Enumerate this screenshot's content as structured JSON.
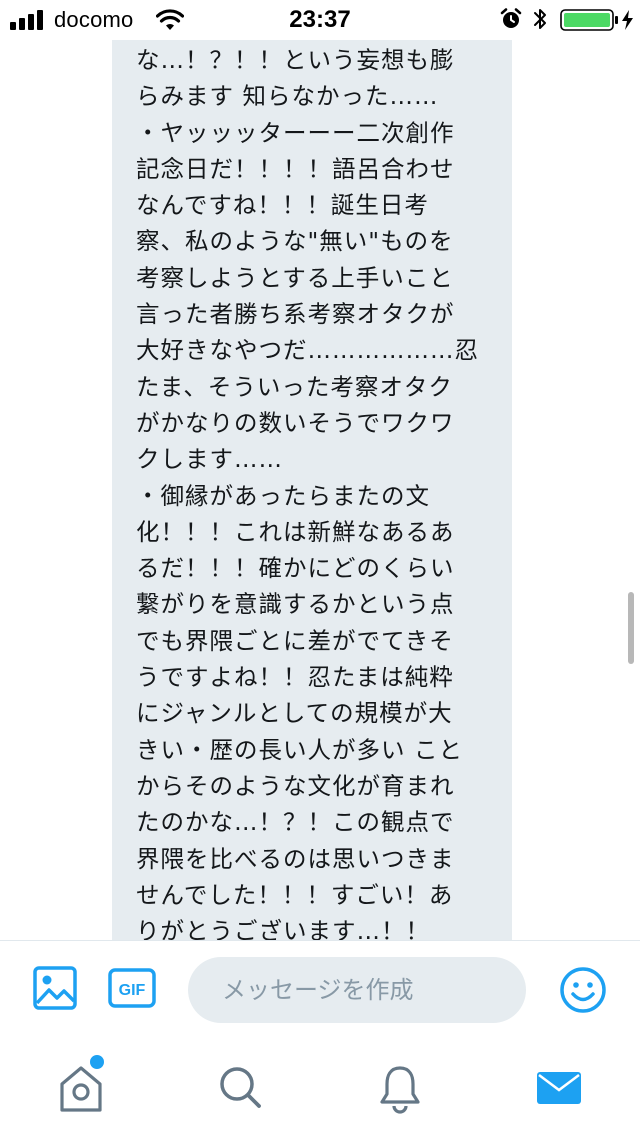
{
  "status_bar": {
    "carrier": "docomo",
    "time": "23:37"
  },
  "message": {
    "lines": [
      "な…！？！！という妄想も膨",
      "らみます 知らなかった……",
      "・ヤッッッターーー二次創作",
      "記念日だ！！！！語呂合わせ",
      "なんですね！！！誕生日考",
      "察、私のような\"無い\"ものを",
      "考察しようとする上手いこと",
      "言った者勝ち系考察オタクが",
      "大好きなやつだ………………忍",
      "たま、そういった考察オタク",
      "がかなりの数いそうでワクワ",
      "クします……",
      "・御縁があったらまたの文",
      "化！！！これは新鮮なあるあ",
      "るだ！！！確かにどのくらい",
      "繋がりを意識するかという点",
      "でも界隈ごとに差がでてきそ",
      "うですよね！！忍たまは純粋",
      "にジャンルとしての規模が大",
      "きい・歴の長い人が多い こと",
      "からそのような文化が育まれ",
      "たのかな…！？！この観点で",
      "界隈を比べるのは思いつきま",
      "せんでした！！！すごい！あ",
      "りがとうございます…！！"
    ]
  },
  "composer": {
    "placeholder": "メッセージを作成",
    "value": "",
    "gif_label": "GIF"
  },
  "icons": {
    "image": "image-icon",
    "gif": "gif-icon",
    "emoji": "emoji-icon",
    "home": "home-icon",
    "search": "search-icon",
    "notifications": "bell-icon",
    "messages": "envelope-icon"
  },
  "colors": {
    "accent": "#1da1f2",
    "bubble": "#e6ecf0",
    "text": "#14171a",
    "inactive_icon": "#657786",
    "placeholder": "#8899a6",
    "battery": "#4cd964"
  },
  "tabs": {
    "active": "messages"
  }
}
